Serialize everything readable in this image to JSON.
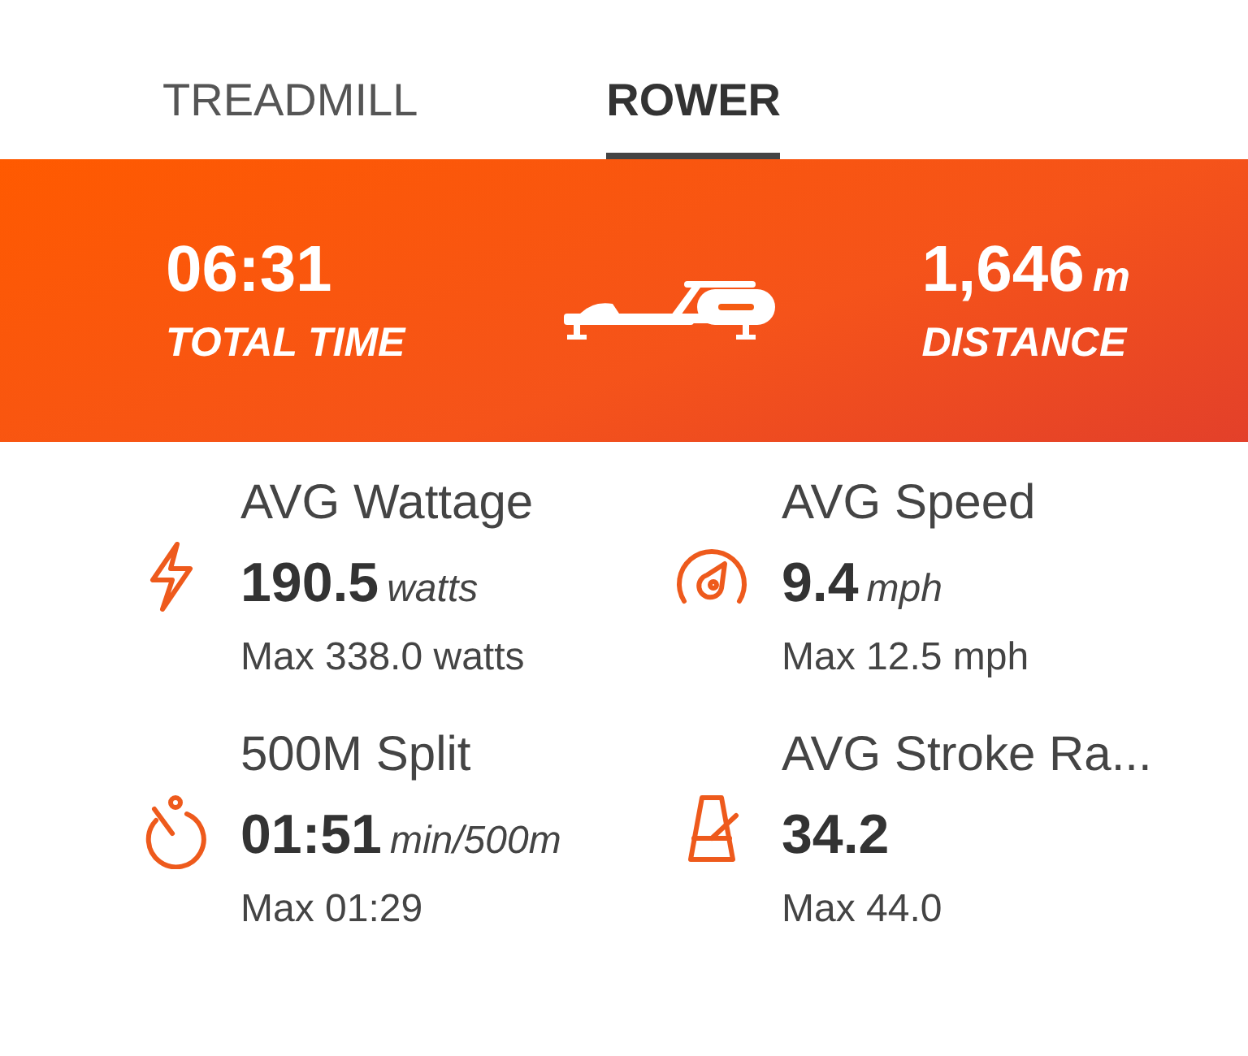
{
  "tabs": [
    {
      "label": "TREADMILL",
      "selected": false
    },
    {
      "label": "ROWER",
      "selected": true
    }
  ],
  "summary": [
    {
      "value": "06:31",
      "label": "TOTAL TIME"
    },
    {
      "value": "1,646",
      "unit": "m",
      "label": "DISTANCE"
    }
  ],
  "stats": [
    {
      "title": "AVG Wattage",
      "value": "190.5",
      "unit": "watts",
      "max": "Max 338.0 watts"
    },
    {
      "title": "AVG Speed",
      "value": "9.4",
      "unit": "mph",
      "max": "Max 12.5 mph"
    },
    {
      "title": "500M Split",
      "value": "01:51",
      "unit": "min/500m",
      "max": "Max 01:29"
    },
    {
      "title": "AVG Stroke Ra...",
      "value": "34.2",
      "max": "Max 44.0"
    }
  ]
}
